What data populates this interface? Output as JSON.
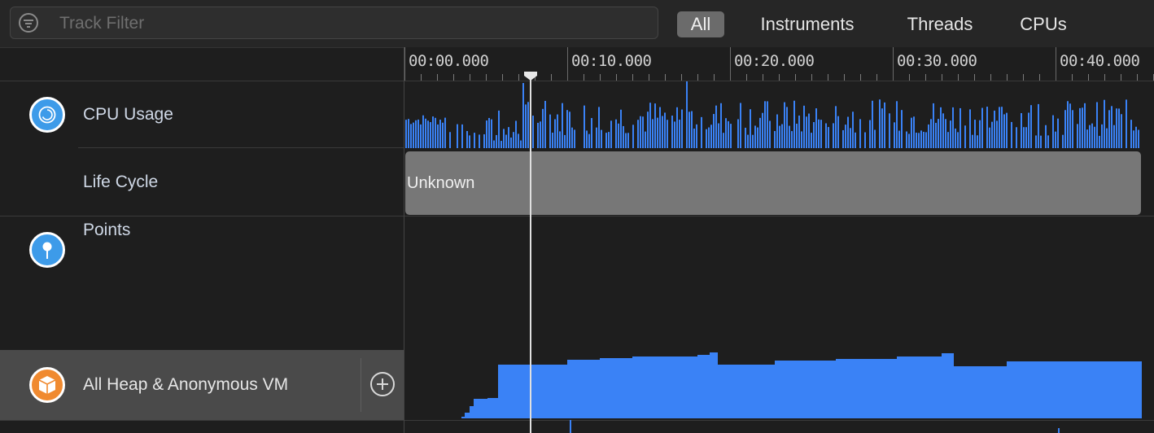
{
  "toolbar": {
    "filter_placeholder": "Track Filter",
    "segments": [
      {
        "label": "All",
        "active": true
      },
      {
        "label": "Instruments",
        "active": false
      },
      {
        "label": "Threads",
        "active": false
      },
      {
        "label": "CPUs",
        "active": false
      }
    ]
  },
  "timeline": {
    "ticks": [
      "00:00.000",
      "00:10.000",
      "00:20.000",
      "00:30.000",
      "00:40.000"
    ],
    "playhead_seconds": 7.6
  },
  "tracks": {
    "cpu_usage": {
      "label": "CPU Usage",
      "icon": "cpu-gauge-icon"
    },
    "life_cycle": {
      "label": "Life Cycle",
      "state": "Unknown"
    },
    "points": {
      "label": "Points",
      "icon": "pin-icon"
    },
    "heap": {
      "label": "All Heap & Anonymous VM",
      "icon": "box-icon"
    }
  },
  "colors": {
    "accent": "#3a82f6",
    "background": "#1e1e1e",
    "lifecycle_bar": "#777777",
    "heap_icon": "#f08a30",
    "cpu_icon": "#3d9be9"
  }
}
